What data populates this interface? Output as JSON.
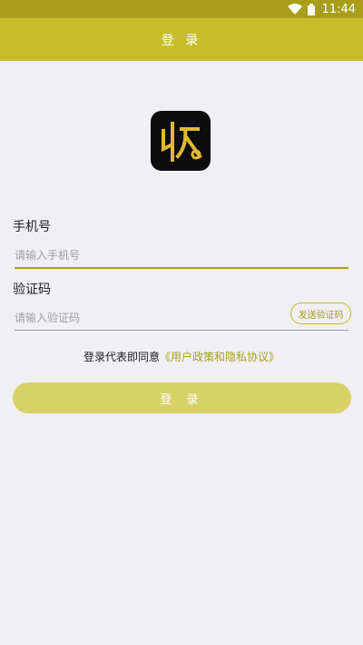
{
  "status_bar": {
    "time": "11:44",
    "wifi_icon": "wifi-icon",
    "battery_icon": "battery-icon"
  },
  "app_bar": {
    "title": "登 录"
  },
  "logo": {
    "icon": "app-logo-icon",
    "accent": "#e0b832",
    "background": "#0d0d0d"
  },
  "form": {
    "phone_label": "手机号",
    "phone_placeholder": "请输入手机号",
    "phone_value": "",
    "code_label": "验证码",
    "code_placeholder": "请输入验证码",
    "code_value": "",
    "send_code_label": "发送验证码"
  },
  "agreement": {
    "prefix": "登录代表即同意",
    "link": "《用户政策和隐私协议》"
  },
  "login_button": {
    "label": "登 录"
  },
  "colors": {
    "status_bar": "#a89e1a",
    "app_bar": "#c7bd2b",
    "accent": "#a89e1a",
    "button": "#d8d167",
    "background": "#f0eff4"
  }
}
